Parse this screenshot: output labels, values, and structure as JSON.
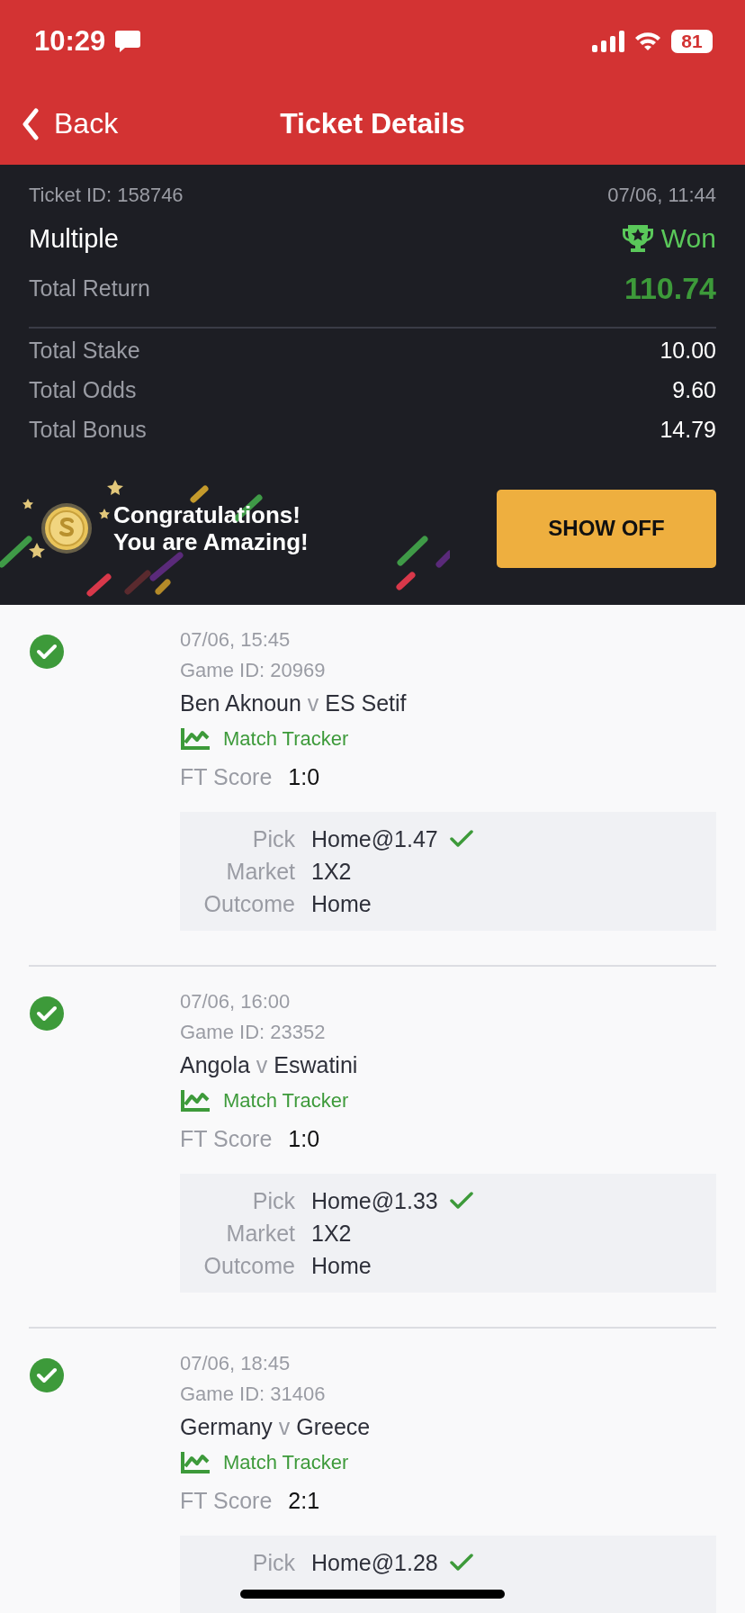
{
  "status_bar": {
    "time": "10:29",
    "battery": "81"
  },
  "nav": {
    "back": "Back",
    "title": "Ticket Details"
  },
  "ticket": {
    "id_label": "Ticket ID: 158746",
    "date": "07/06, 11:44",
    "type": "Multiple",
    "won": true,
    "status_label": "Won",
    "return_label": "Total Return",
    "return_value": "110.74",
    "totals": [
      {
        "label": "Total Stake",
        "value": "10.00"
      },
      {
        "label": "Total Odds",
        "value": "9.60"
      },
      {
        "label": "Total Bonus",
        "value": "14.79"
      }
    ]
  },
  "banner": {
    "line_1": "Congratulations!",
    "line_2": "You are Amazing!",
    "button": "SHOW OFF"
  },
  "games": [
    {
      "won": true,
      "date": "07/06, 15:45",
      "game_id": "Game ID: 20969",
      "home": "Ben Aknoun",
      "sep": "v",
      "away": "ES Setif",
      "tracker": "Match Tracker",
      "score_label": "FT Score",
      "score": "1:0",
      "pick_correct": true,
      "details": [
        {
          "label": "Pick",
          "value": "Home@1.47"
        },
        {
          "label": "Market",
          "value": "1X2"
        },
        {
          "label": "Outcome",
          "value": "Home"
        }
      ]
    },
    {
      "won": true,
      "date": "07/06, 16:00",
      "game_id": "Game ID: 23352",
      "home": "Angola",
      "sep": "v",
      "away": "Eswatini",
      "tracker": "Match Tracker",
      "score_label": "FT Score",
      "score": "1:0",
      "pick_correct": true,
      "details": [
        {
          "label": "Pick",
          "value": "Home@1.33"
        },
        {
          "label": "Market",
          "value": "1X2"
        },
        {
          "label": "Outcome",
          "value": "Home"
        }
      ]
    },
    {
      "won": true,
      "date": "07/06, 18:45",
      "game_id": "Game ID: 31406",
      "home": "Germany",
      "sep": "v",
      "away": "Greece",
      "tracker": "Match Tracker",
      "score_label": "FT Score",
      "score": "2:1",
      "pick_correct": true,
      "details": [
        {
          "label": "Pick",
          "value": "Home@1.28"
        }
      ]
    }
  ]
}
